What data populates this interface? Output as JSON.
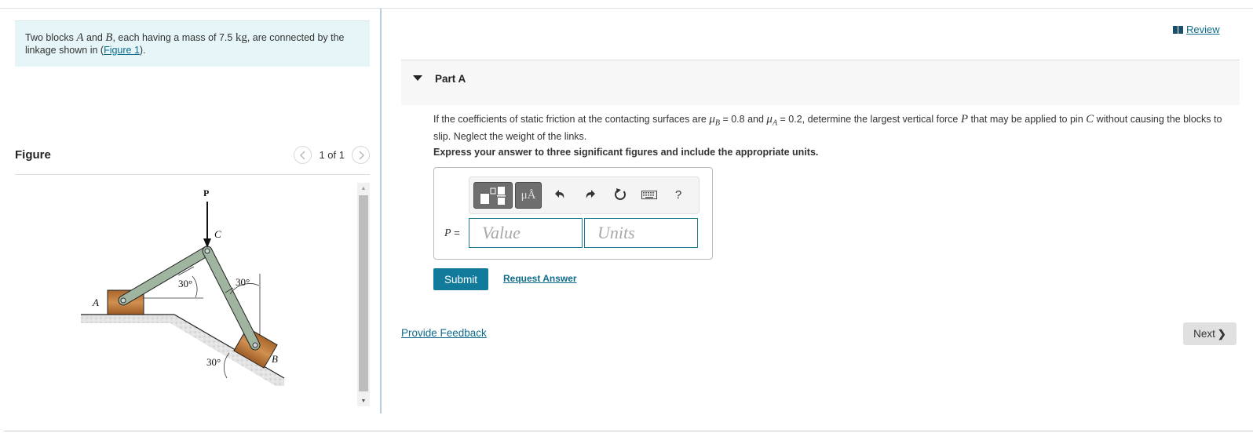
{
  "problem": {
    "text_before_A": "Two blocks ",
    "var_A": "A",
    "text_and": " and ",
    "var_B": "B",
    "text_mass": ", each having a mass of 7.5 ",
    "unit": "kg",
    "text_after": ", are connected by the linkage shown in (",
    "figure_link": "Figure 1",
    "text_close": ")."
  },
  "figure": {
    "title": "Figure",
    "counter": "1 of 1",
    "prev_icon": "chevron-left",
    "next_icon": "chevron-right",
    "labels": {
      "force": "P",
      "pin": "C",
      "block_a": "A",
      "block_b": "B",
      "angle_ac": "30°",
      "angle_bc": "30°",
      "angle_incline": "30°"
    }
  },
  "review": {
    "label": "Review",
    "icon": "book-icon"
  },
  "part": {
    "title": "Part A",
    "question": {
      "t1": "If the coefficients of static friction at the contacting surfaces are ",
      "muB": "μ",
      "subB": "B",
      "t2": " = 0.8 and ",
      "muA": "μ",
      "subA": "A",
      "t3": " = 0.2, determine the largest vertical force ",
      "P": "P",
      "t4": " that may be applied to pin ",
      "C": "C",
      "t5": " without causing the blocks to slip. Neglect the weight of the links."
    },
    "instruction": "Express your answer to three significant figures and include the appropriate units.",
    "toolbar": {
      "templates_icon": "templates-icon",
      "units_label": "μÅ",
      "undo_icon": "↶",
      "redo_icon": "↷",
      "reset_icon": "↻",
      "keyboard_icon": "keyboard-icon",
      "help_label": "?"
    },
    "answer": {
      "label": "P =",
      "value_placeholder": "Value",
      "value": "",
      "units_placeholder": "Units",
      "units": ""
    },
    "submit_label": "Submit",
    "request_answer_label": "Request Answer"
  },
  "feedback_label": "Provide Feedback",
  "next_label": "Next",
  "colors": {
    "accent": "#127a9b",
    "link": "#0f6b8c",
    "problem_bg": "#e6f5f7",
    "link_bar": "#9fb59f",
    "block": "#b8743a"
  }
}
